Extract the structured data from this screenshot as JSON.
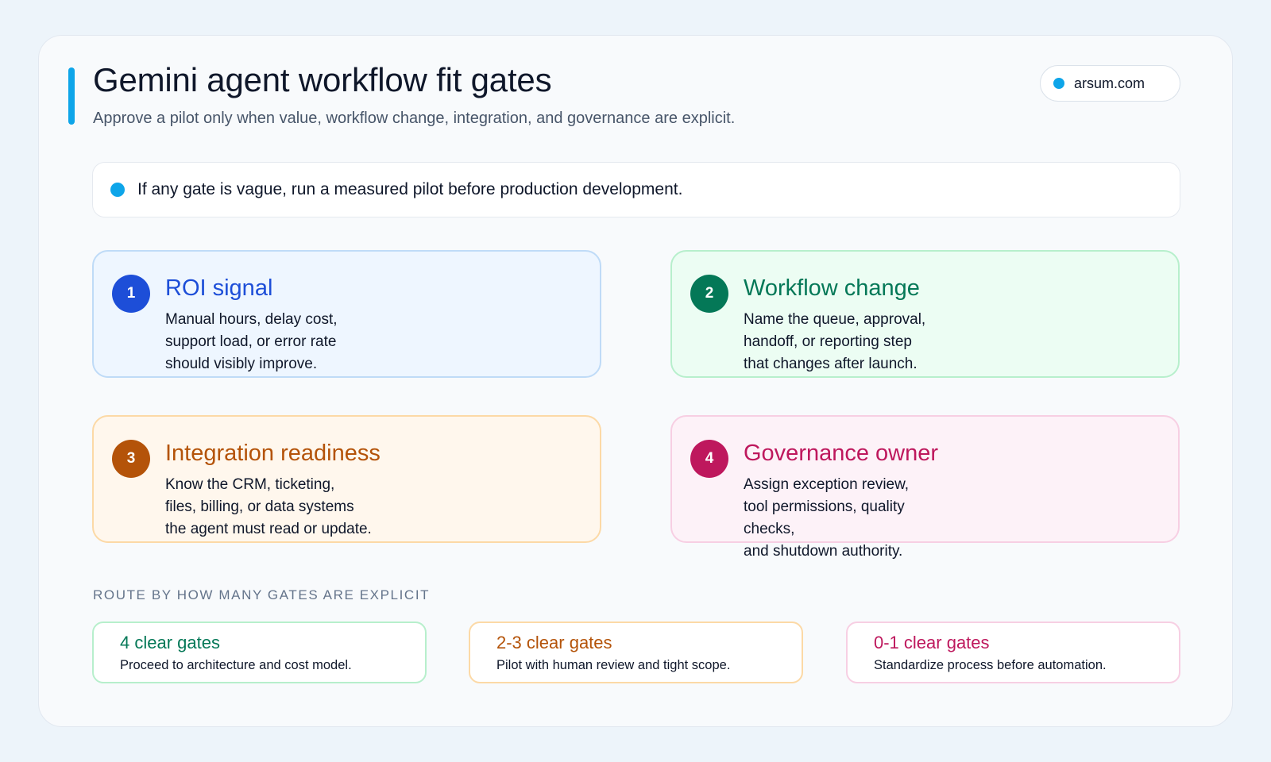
{
  "header": {
    "title": "Gemini agent workflow fit gates",
    "subtitle": "Approve a pilot only when value, workflow change, integration, and governance are explicit.",
    "source": "arsum.com"
  },
  "note": {
    "text": "If any gate is vague, run a measured pilot before production development."
  },
  "gates": [
    {
      "number": "1",
      "title": "ROI signal",
      "lines": [
        "Manual hours, delay cost,",
        "support load, or error rate",
        "should visibly improve."
      ],
      "color": "#1d4ed8"
    },
    {
      "number": "2",
      "title": "Workflow change",
      "lines": [
        "Name the queue, approval,",
        "handoff, or reporting step",
        "that changes after launch."
      ],
      "color": "#047857"
    },
    {
      "number": "3",
      "title": "Integration readiness",
      "lines": [
        "Know the CRM, ticketing,",
        "files, billing, or data systems",
        "the agent must read or update."
      ],
      "color": "#b45309"
    },
    {
      "number": "4",
      "title": "Governance owner",
      "lines": [
        "Assign exception review,",
        "tool permissions, quality checks,",
        "and shutdown authority."
      ],
      "color": "#be185d"
    }
  ],
  "routing": {
    "heading": "ROUTE BY HOW MANY GATES ARE EXPLICIT",
    "options": [
      {
        "title": "4 clear gates",
        "description": "Proceed to architecture and cost model.",
        "color": "#047857"
      },
      {
        "title": "2-3 clear gates",
        "description": "Pilot with human review and tight scope.",
        "color": "#b45309"
      },
      {
        "title": "0-1 clear gates",
        "description": "Standardize process before automation.",
        "color": "#be185d"
      }
    ]
  }
}
